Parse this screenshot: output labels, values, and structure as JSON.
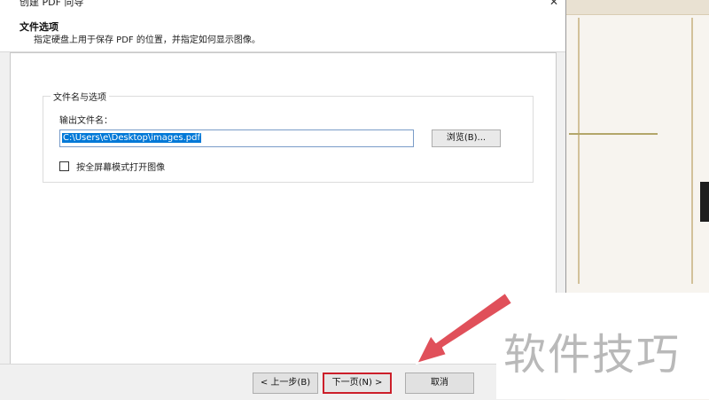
{
  "window": {
    "title": "创建 PDF 向导",
    "close_glyph": "✕"
  },
  "header": {
    "title": "文件选项",
    "description": "指定硬盘上用于保存 PDF 的位置，并指定如何显示图像。"
  },
  "group": {
    "legend": "文件名与选项",
    "output_label": "输出文件名：",
    "output_value": "C:\\Users\\e\\Desktop\\images.pdf",
    "browse_label": "浏览(B)...",
    "fullscreen_checkbox_label": "按全屏幕模式打开图像",
    "fullscreen_checked": false
  },
  "buttons": {
    "back": "< 上一步(B)",
    "next": "下一页(N) >",
    "cancel": "取消"
  },
  "watermark": "软件技巧",
  "colors": {
    "highlight": "#cc1f2a",
    "selection": "#0078d7",
    "arrow": "#e0505a"
  }
}
